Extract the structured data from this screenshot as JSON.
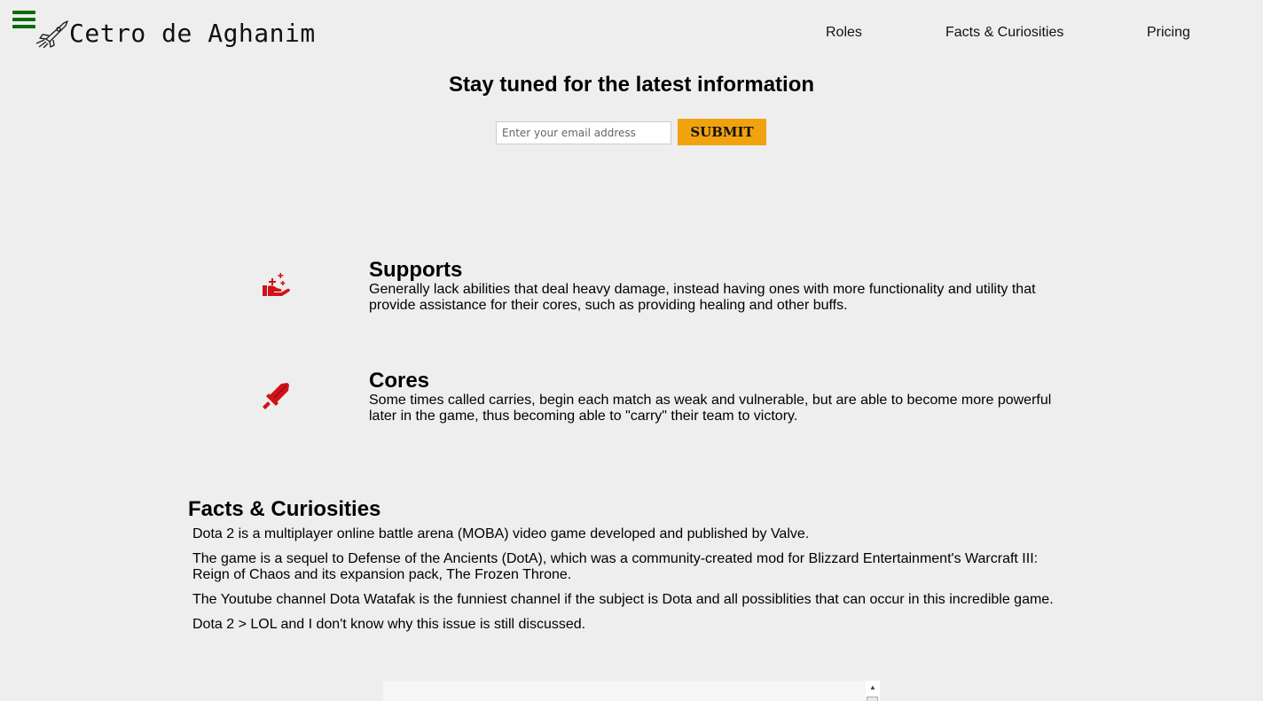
{
  "header": {
    "logo_text": "Cetro de Aghanim",
    "nav": [
      "Roles",
      "Facts & Curiosities",
      "Pricing"
    ]
  },
  "newsletter": {
    "title": "Stay tuned for the latest information",
    "email_placeholder": "Enter your email address",
    "submit_label": "SUBMIT"
  },
  "roles": [
    {
      "title": "Supports",
      "icon": "helping-hand-icon",
      "description": "Generally lack abilities that deal heavy damage, instead having ones with more functionality and utility that provide assistance for their cores, such as providing healing and other buffs."
    },
    {
      "title": "Cores",
      "icon": "sword-icon",
      "description": "Some times called carries, begin each match as weak and vulnerable, but are able to become more powerful later in the game, thus becoming able to \"carry\" their team to victory."
    }
  ],
  "facts": {
    "title": "Facts & Curiosities",
    "items": [
      "Dota 2 is a multiplayer online battle arena (MOBA) video game developed and published by Valve.",
      "The game is a sequel to Defense of the Ancients (DotA), which was a community-created mod for Blizzard Entertainment's Warcraft III: Reign of Chaos and its expansion pack, The Frozen Throne.",
      "The Youtube channel Dota Watafak is the funniest channel if the subject is Dota and all possiblities that can occur in this incredible game.",
      "Dota 2 > LOL and I don't know why this issue is still discussed."
    ]
  },
  "colors": {
    "accent": "#f1a30f",
    "icon_red": "#d0121b",
    "menu_green": "#0a6b0a",
    "background": "#eeeeee"
  }
}
